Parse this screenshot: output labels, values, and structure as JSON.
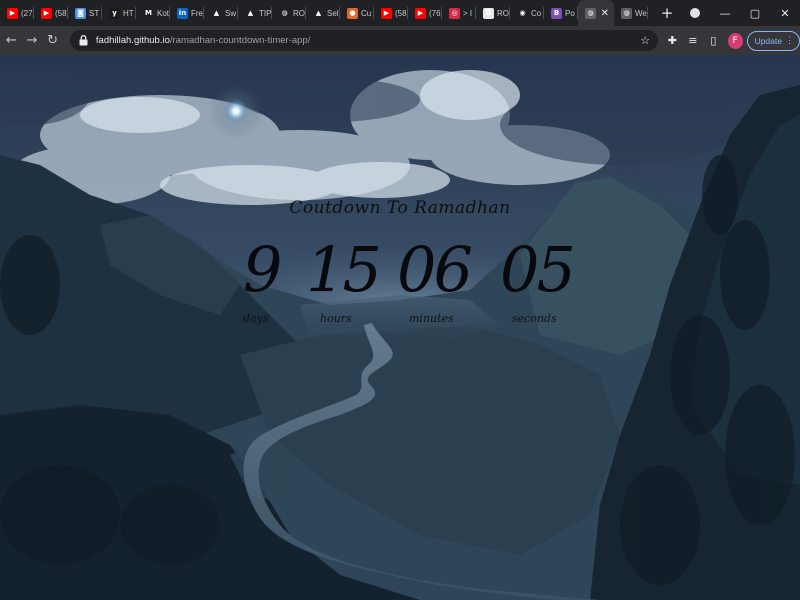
{
  "browser": {
    "tabs": [
      {
        "label": "(27)",
        "icon": "youtube-icon",
        "color": "#ff0000",
        "glyph": "▶"
      },
      {
        "label": "(58)",
        "icon": "youtube-icon",
        "color": "#ff0000",
        "glyph": "▶"
      },
      {
        "label": "ST",
        "icon": "site-icon",
        "color": "#4f8fe6",
        "glyph": "◙"
      },
      {
        "label": "HT",
        "icon": "site-icon",
        "color": "#1a1a1a",
        "glyph": "y"
      },
      {
        "label": "Kot",
        "icon": "gmail-icon",
        "color": "#202124",
        "glyph": "M"
      },
      {
        "label": "Fre",
        "icon": "linkedin-icon",
        "color": "#0a66c2",
        "glyph": "in"
      },
      {
        "label": "Sw",
        "icon": "site-icon",
        "color": "#202124",
        "glyph": "▲"
      },
      {
        "label": "TIPS",
        "icon": "drive-icon",
        "color": "#202124",
        "glyph": "▲"
      },
      {
        "label": "RO",
        "icon": "globe-icon",
        "color": "#202124",
        "glyph": "◍"
      },
      {
        "label": "Sel",
        "icon": "drive-icon",
        "color": "#202124",
        "glyph": "▲"
      },
      {
        "label": "Cu",
        "icon": "site-icon",
        "color": "#e06a2c",
        "glyph": "●"
      },
      {
        "label": "(58",
        "icon": "youtube-icon",
        "color": "#ff0000",
        "glyph": "▶"
      },
      {
        "label": "(76",
        "icon": "youtube-icon",
        "color": "#ff0000",
        "glyph": "▶"
      },
      {
        "label": "> I",
        "icon": "site-icon",
        "color": "#d3294a",
        "glyph": "◎"
      },
      {
        "label": "RO",
        "icon": "site-icon",
        "color": "#e8e8e8",
        "glyph": "◘"
      },
      {
        "label": "Co",
        "icon": "github-icon",
        "color": "#202124",
        "glyph": "◉"
      },
      {
        "label": "Po",
        "icon": "site-icon",
        "color": "#7952b3",
        "glyph": "B"
      }
    ],
    "active_tab": {
      "label": "",
      "icon": "globe-icon"
    },
    "last_tab": {
      "label": "We",
      "icon": "globe-icon"
    },
    "url_host": "fadhillah.github.io",
    "url_path": "/ramadhan-countdown-timer-app/",
    "avatar_letter": "F",
    "update_label": "Update"
  },
  "page": {
    "title": "Coutdown To Ramadhan",
    "units": [
      {
        "value": "9",
        "label": "days"
      },
      {
        "value": "15",
        "label": "hours"
      },
      {
        "value": "06",
        "label": "minutes"
      },
      {
        "value": "05",
        "label": "seconds"
      }
    ]
  }
}
